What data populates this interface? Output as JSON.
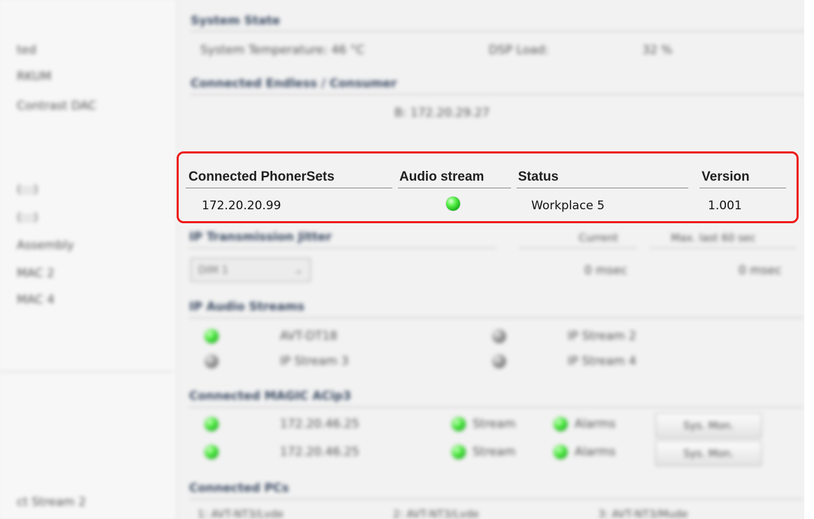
{
  "sidebar": {
    "items": [
      {
        "label": "ted"
      },
      {
        "label": "RKUM"
      },
      {
        "label": "Contrast DAC"
      },
      {
        "label": "(:::)"
      },
      {
        "label": "(:::)"
      },
      {
        "label": "Assembly"
      },
      {
        "label": "MAC 2"
      },
      {
        "label": "MAC 4"
      },
      {
        "label": "ct Stream 2"
      }
    ]
  },
  "system_state": {
    "title": "System State",
    "temperature": "System Temperature: 46 °C",
    "dsp_label": "DSP Load:",
    "dsp_value": "32 %"
  },
  "connected_endless": {
    "title": "Connected Endless / Consumer",
    "value": "B: 172.20.29.27"
  },
  "phonersets": {
    "headers": {
      "name": "Connected PhonerSets",
      "audio": "Audio stream",
      "status": "Status",
      "version": "Version"
    },
    "rows": [
      {
        "ip": "172.20.20.99",
        "audio": "active",
        "status": "Workplace 5",
        "version": "1.001"
      }
    ]
  },
  "ip_jitter": {
    "title": "IP Transmission Jitter",
    "current_label": "Current",
    "max_label": "Max. last 60 sec",
    "select_value": "DIM 1",
    "current_value": "0 msec",
    "max_value": "0 msec"
  },
  "ip_audio": {
    "title": "IP Audio Streams",
    "streams": [
      {
        "label": "AVT-DT18",
        "state": "green"
      },
      {
        "label": "IP Stream 2",
        "state": "gray"
      },
      {
        "label": "IP Stream 3",
        "state": "gray"
      },
      {
        "label": "IP Stream 4",
        "state": "gray"
      }
    ]
  },
  "magic": {
    "title": "Connected MAGIC ACip3",
    "rows": [
      {
        "ip": "172.20.46.25",
        "stream": "Stream",
        "alarms": "Alarms",
        "button": "Sys. Mon."
      },
      {
        "ip": "172.20.46.25",
        "stream": "Stream",
        "alarms": "Alarms",
        "button": "Sys. Mon."
      }
    ]
  },
  "pcs": {
    "title": "Connected PCs",
    "items": [
      {
        "label": "1: AVT-NT3/Lvde"
      },
      {
        "label": "2: AVT-NT3/Lvde"
      },
      {
        "label": "3: AVT-NT3/Mude"
      }
    ]
  },
  "colors": {
    "highlight": "#ee1b1b",
    "led_green": "#17b217",
    "led_gray": "#7a7a7a"
  }
}
